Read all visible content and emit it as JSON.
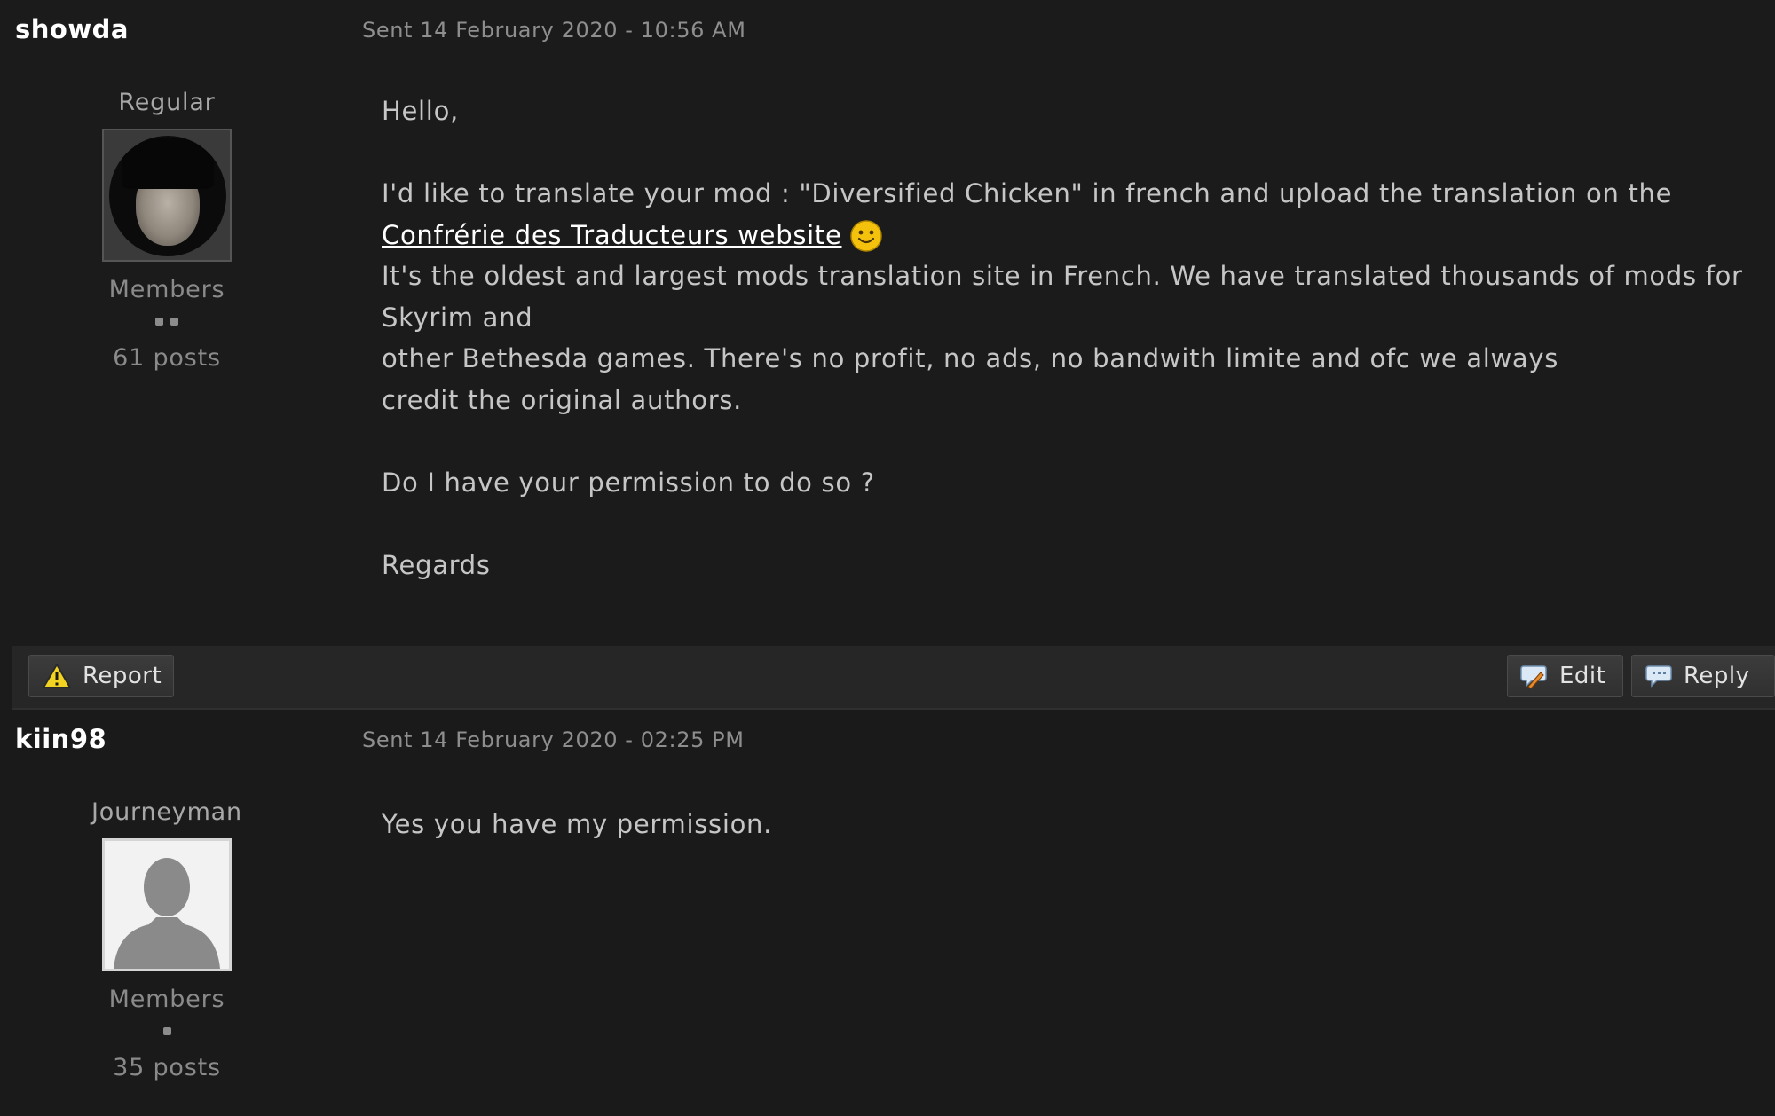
{
  "posts": [
    {
      "author": "showda",
      "date": "Sent 14 February 2020 - 10:56 AM",
      "rank": "Regular",
      "group": "Members",
      "pips": 2,
      "post_count": "61 posts",
      "body": {
        "greeting": "Hello,",
        "line1_text": "I'd like to translate your mod : \"Diversified Chicken\" in french and upload the translation on the ",
        "link_text": "Confrérie des Traducteurs website",
        "line2": "It's the oldest and largest mods translation site in French. We have translated thousands of mods for Skyrim and",
        "line3": "other Bethesda games. There's no profit, no ads, no bandwith limite and ofc we always credit the original authors.",
        "question": "Do I have your permission to do so ?",
        "closing": "Regards"
      }
    },
    {
      "author": "kiin98",
      "date": "Sent 14 February 2020 - 02:25 PM",
      "rank": "Journeyman",
      "group": "Members",
      "pips": 1,
      "post_count": "35 posts",
      "body": {
        "text": "Yes you have my permission."
      }
    }
  ],
  "actions": {
    "report_label": "Report",
    "edit_label": "Edit",
    "reply_label": "Reply",
    "report_icon": "warning-icon",
    "edit_icon": "edit-bubble-icon",
    "reply_icon": "reply-bubble-icon"
  },
  "colors": {
    "background": "#1b1b1b",
    "link": "#ffffff",
    "action_bar": "#262626"
  }
}
